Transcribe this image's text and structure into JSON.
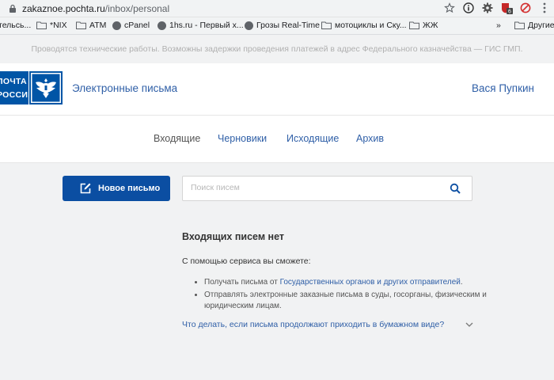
{
  "browser": {
    "url_domain": "zakaznoe.pochta.ru",
    "url_path": "/inbox/personal",
    "bookmarks": [
      {
        "label": "тельсь...",
        "icon": "none"
      },
      {
        "label": "*NIX",
        "icon": "folder-icon"
      },
      {
        "label": "ATM",
        "icon": "folder-icon"
      },
      {
        "label": "cPanel",
        "icon": "globe-icon"
      },
      {
        "label": "1hs.ru - Первый х...",
        "icon": "globe-icon"
      },
      {
        "label": "Грозы Real-Time",
        "icon": "globe-icon"
      },
      {
        "label": "мотоциклы и Ску...",
        "icon": "folder-icon"
      },
      {
        "label": "ЖЖ",
        "icon": "folder-icon"
      }
    ],
    "overflow": "»",
    "other_bookmarks": "Другие"
  },
  "notice": "Проводятся технические работы. Возможны задержки проведения платежей в адрес Федерального казначейства — ГИС ГМП.",
  "header": {
    "logo_line1": "ПОЧТА",
    "logo_line2": "РОССИИ",
    "service_title": "Электронные письма",
    "username": "Вася Пупкин"
  },
  "tabs": [
    {
      "label": "Входящие",
      "active": true
    },
    {
      "label": "Черновики",
      "active": false
    },
    {
      "label": "Исходящие",
      "active": false
    },
    {
      "label": "Архив",
      "active": false
    }
  ],
  "new_letter_button": "Новое письмо",
  "search": {
    "placeholder": "Поиск писем",
    "value": ""
  },
  "empty": {
    "title": "Входящих писем нет",
    "intro": "С помощью сервиса вы сможете:",
    "feature1_prefix": "Получать письма от ",
    "feature1_link": "Государственных органов и других отправителей",
    "feature1_suffix": ".",
    "feature2": "Отправлять электронные заказные письма в суды, госорганы, физическим и юридическим лицам."
  },
  "faq": "Что делать, если письма продолжают приходить в бумажном виде?",
  "colors": {
    "brand": "#0055a6",
    "link": "#2f5fa7",
    "button": "#0b4ea2"
  }
}
